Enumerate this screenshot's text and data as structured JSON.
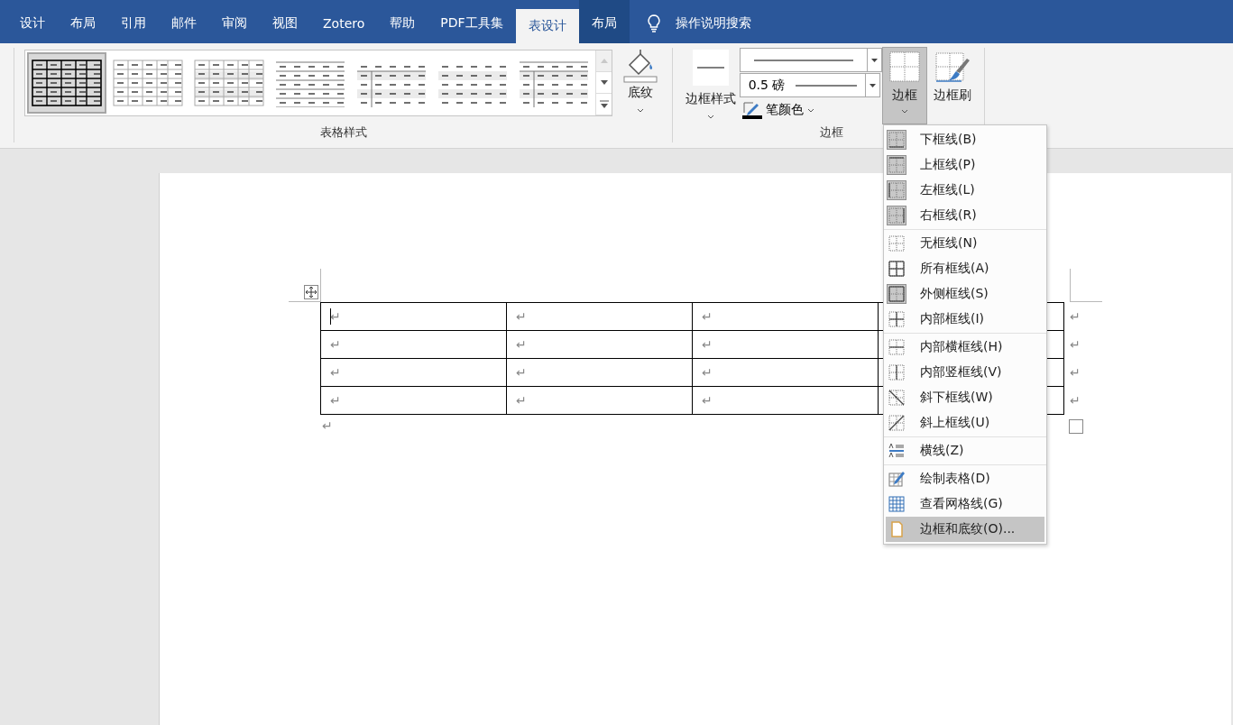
{
  "tabs": [
    {
      "label": "设计",
      "selected": false,
      "contextual": false
    },
    {
      "label": "布局",
      "selected": false,
      "contextual": false
    },
    {
      "label": "引用",
      "selected": false,
      "contextual": false
    },
    {
      "label": "邮件",
      "selected": false,
      "contextual": false
    },
    {
      "label": "审阅",
      "selected": false,
      "contextual": false
    },
    {
      "label": "视图",
      "selected": false,
      "contextual": false
    },
    {
      "label": "Zotero",
      "selected": false,
      "contextual": false
    },
    {
      "label": "帮助",
      "selected": false,
      "contextual": false
    },
    {
      "label": "PDF工具集",
      "selected": false,
      "contextual": false
    },
    {
      "label": "表设计",
      "selected": true,
      "contextual": true
    },
    {
      "label": "布局",
      "selected": false,
      "contextual": true
    }
  ],
  "tell_me": "操作说明搜索",
  "table_styles": {
    "label": "表格样式",
    "styles": [
      {
        "kind": "grid-bold",
        "selected": true
      },
      {
        "kind": "grid-light",
        "selected": false
      },
      {
        "kind": "grid-shaded",
        "selected": false
      },
      {
        "kind": "lines",
        "selected": false
      },
      {
        "kind": "header-column",
        "selected": false
      },
      {
        "kind": "banded",
        "selected": false
      },
      {
        "kind": "header-column-lines",
        "selected": false
      }
    ]
  },
  "shading": {
    "label": "底纹"
  },
  "borders": {
    "label": "边框",
    "border_styles": "边框样式",
    "line_weight": "0.5 磅",
    "pen_color": "笔颜色",
    "borders_button": {
      "label": "边框",
      "selected": true
    },
    "border_painter": "边框刷"
  },
  "table": {
    "rows": [
      {
        "cells": [
          "↵",
          "↵",
          "↵"
        ],
        "row_end": "↵"
      },
      {
        "cells": [
          "↵",
          "↵",
          "↵"
        ],
        "row_end": "↵"
      },
      {
        "cells": [
          "↵",
          "↵",
          "↵"
        ],
        "row_end": "↵"
      },
      {
        "cells": [
          "↵",
          "↵",
          "↵"
        ],
        "row_end": "↵"
      }
    ],
    "after_mark": "↵"
  },
  "borders_menu": {
    "groups": [
      [
        {
          "kind": "bottom",
          "label": "下框线(B)",
          "checked": true,
          "selected": false
        },
        {
          "kind": "top",
          "label": "上框线(P)",
          "checked": true,
          "selected": false
        },
        {
          "kind": "left",
          "label": "左框线(L)",
          "checked": true,
          "selected": false
        },
        {
          "kind": "right",
          "label": "右框线(R)",
          "checked": true,
          "selected": false
        }
      ],
      [
        {
          "kind": "none",
          "label": "无框线(N)",
          "checked": false,
          "selected": false
        },
        {
          "kind": "all",
          "label": "所有框线(A)",
          "checked": false,
          "selected": false
        },
        {
          "kind": "outside",
          "label": "外侧框线(S)",
          "checked": true,
          "selected": false
        },
        {
          "kind": "inside",
          "label": "内部框线(I)",
          "checked": false,
          "selected": false
        }
      ],
      [
        {
          "kind": "inside-h",
          "label": "内部横框线(H)",
          "checked": false,
          "selected": false
        },
        {
          "kind": "inside-v",
          "label": "内部竖框线(V)",
          "checked": false,
          "selected": false
        },
        {
          "kind": "diag-down",
          "label": "斜下框线(W)",
          "checked": false,
          "selected": false
        },
        {
          "kind": "diag-up",
          "label": "斜上框线(U)",
          "checked": false,
          "selected": false
        }
      ],
      [
        {
          "kind": "hline",
          "label": "横线(Z)",
          "checked": false,
          "selected": false
        }
      ],
      [
        {
          "kind": "draw",
          "label": "绘制表格(D)",
          "checked": false,
          "selected": false
        },
        {
          "kind": "grid",
          "label": "查看网格线(G)",
          "checked": false,
          "selected": false
        },
        {
          "kind": "dialog",
          "label": "边框和底纹(O)...",
          "checked": false,
          "selected": true
        }
      ]
    ]
  }
}
